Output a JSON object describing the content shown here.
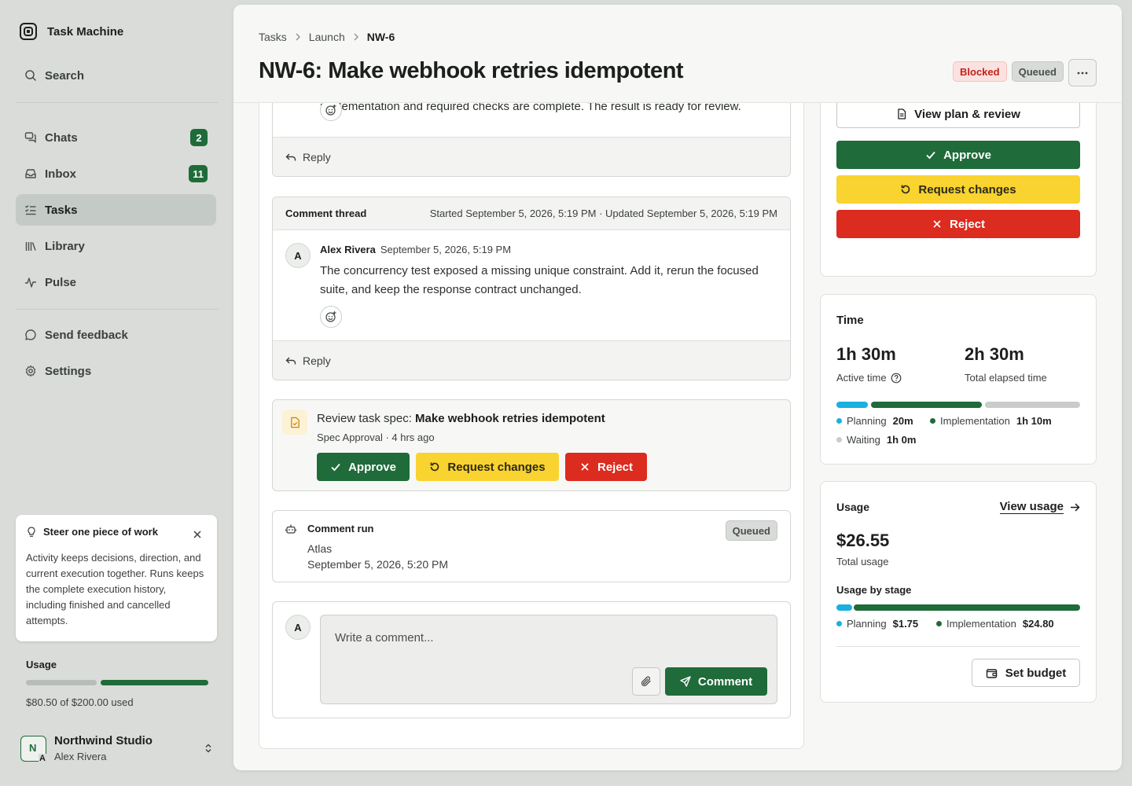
{
  "app": {
    "name": "Task Machine"
  },
  "sidebar": {
    "search_label": "Search",
    "nav": [
      {
        "label": "Chats",
        "badge": "2"
      },
      {
        "label": "Inbox",
        "badge": "11"
      },
      {
        "label": "Tasks",
        "active": true
      },
      {
        "label": "Library"
      },
      {
        "label": "Pulse"
      }
    ],
    "secondary": [
      {
        "label": "Send feedback"
      },
      {
        "label": "Settings"
      }
    ],
    "tip": {
      "title": "Steer one piece of work",
      "body": "Activity keeps decisions, direction, and current execution together. Runs keeps the complete execution history, including finished and cancelled attempts."
    },
    "usage": {
      "title": "Usage",
      "text": "$80.50 of $200.00 used",
      "fraction": 0.4025
    },
    "workspace": {
      "name": "Northwind Studio",
      "user": "Alex Rivera",
      "initial": "N",
      "user_initial": "A"
    }
  },
  "header": {
    "breadcrumbs": [
      "Tasks",
      "Launch",
      "NW-6"
    ],
    "title": "NW-6: Make webhook retries idempotent",
    "badges": {
      "blocked": "Blocked",
      "queued": "Queued"
    },
    "more_label": "···"
  },
  "activity": {
    "prev_comment_tail": "implementation and required checks are complete. The result is ready for review.",
    "reply_label": "Reply",
    "thread": {
      "title": "Comment thread",
      "meta": "Started September 5, 2026, 5:19 PM · Updated September 5, 2026, 5:19 PM",
      "author_initial": "A",
      "author": "Alex Rivera",
      "time": "September 5, 2026, 5:19 PM",
      "text": "The concurrency test exposed a missing unique constraint. Add it, rerun the focused suite, and keep the response contract unchanged."
    },
    "spec": {
      "prefix": "Review task spec: ",
      "title": "Make webhook retries idempotent",
      "sub": "Spec Approval · 4 hrs ago",
      "approve": "Approve",
      "request_changes": "Request changes",
      "reject": "Reject"
    },
    "run": {
      "title": "Comment run",
      "who": "Atlas",
      "when": "September 5, 2026, 5:20 PM",
      "status": "Queued"
    },
    "composer": {
      "avatar": "A",
      "placeholder": "Write a comment...",
      "submit": "Comment"
    }
  },
  "review": {
    "view_plan": "View plan & review",
    "approve": "Approve",
    "request_changes": "Request changes",
    "reject": "Reject"
  },
  "time": {
    "title": "Time",
    "active_value": "1h 30m",
    "active_label": "Active time",
    "elapsed_value": "2h 30m",
    "elapsed_label": "Total elapsed time",
    "segments": [
      {
        "name": "Planning",
        "value": "20m",
        "minutes": 20,
        "color": "#1ab0e0"
      },
      {
        "name": "Implementation",
        "value": "1h 10m",
        "minutes": 70,
        "color": "#1f6b3a"
      },
      {
        "name": "Waiting",
        "value": "1h 0m",
        "minutes": 60,
        "color": "#c9ccc9"
      }
    ]
  },
  "usage": {
    "title": "Usage",
    "view_label": "View usage",
    "total_value": "$26.55",
    "total_label": "Total usage",
    "stage_title": "Usage by stage",
    "segments": [
      {
        "name": "Planning",
        "value": "$1.75",
        "amount": 1.75,
        "color": "#1ab0e0"
      },
      {
        "name": "Implementation",
        "value": "$24.80",
        "amount": 24.8,
        "color": "#1f6b3a"
      }
    ],
    "budget_label": "Set budget"
  }
}
